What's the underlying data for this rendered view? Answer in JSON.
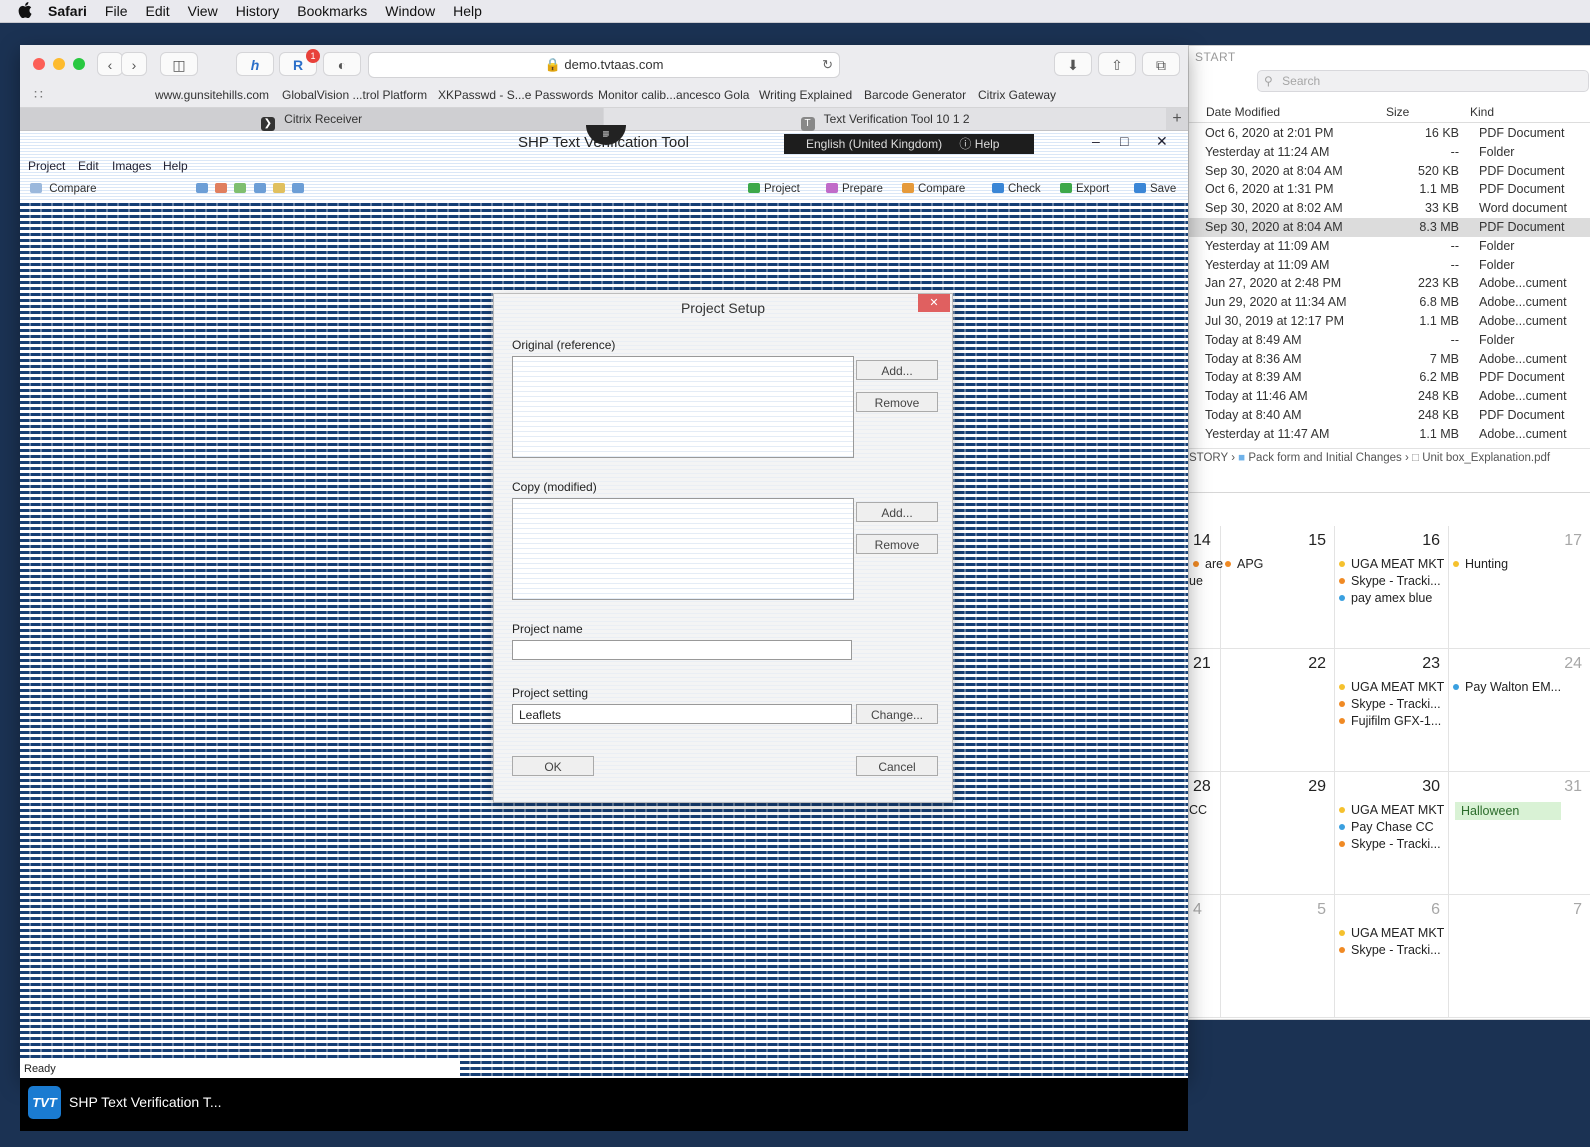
{
  "menubar": {
    "apple": "",
    "items": [
      "Safari",
      "File",
      "Edit",
      "View",
      "History",
      "Bookmarks",
      "Window",
      "Help"
    ]
  },
  "safari": {
    "url": "demo.tvtaas.com",
    "badge": "1",
    "favorites": [
      "www.gunsitehills.com",
      "GlobalVision ...trol Platform",
      "XKPasswd - S...e Passwords",
      "Monitor calib...ancesco Gola",
      "Writing Explained",
      "Barcode Generator",
      "Citrix Gateway"
    ],
    "tabs": [
      {
        "label": "Citrix Receiver",
        "icon": "citrix-icon"
      },
      {
        "label": "Text Verification Tool 10 1 2",
        "icon": "tvt-icon",
        "icon_glyph": "T"
      }
    ],
    "new_tab": "+"
  },
  "app": {
    "title": "SHP Text Verification Tool",
    "language": "English (United Kingdom)",
    "help": "Help",
    "menus": [
      "Project",
      "Edit",
      "Images",
      "Help"
    ],
    "left_tool": "Compare",
    "right_tools": [
      "Project",
      "Prepare",
      "Compare",
      "Check",
      "Export",
      "Save"
    ],
    "status": "Ready"
  },
  "dialog": {
    "title": "Project Setup",
    "original_label": "Original (reference)",
    "copy_label": "Copy (modified)",
    "add": "Add...",
    "remove": "Remove",
    "project_name_label": "Project name",
    "project_setting_label": "Project setting",
    "project_setting_value": "Leaflets",
    "change": "Change...",
    "ok": "OK",
    "cancel": "Cancel"
  },
  "finder": {
    "title": "START",
    "search_placeholder": "Search",
    "columns": {
      "date": "Date Modified",
      "size": "Size",
      "kind": "Kind"
    },
    "rows": [
      {
        "date": "Oct 6, 2020 at 2:01 PM",
        "size": "16 KB",
        "kind": "PDF Document"
      },
      {
        "date": "Yesterday at 11:24 AM",
        "size": "--",
        "kind": "Folder"
      },
      {
        "date": "Sep 30, 2020 at 8:04 AM",
        "size": "520 KB",
        "kind": "PDF Document"
      },
      {
        "date": "Oct 6, 2020 at 1:31 PM",
        "size": "1.1 MB",
        "kind": "PDF Document"
      },
      {
        "date": "Sep 30, 2020 at 8:02 AM",
        "size": "33 KB",
        "kind": "Word document"
      },
      {
        "date": "Sep 30, 2020 at 8:04 AM",
        "size": "8.3 MB",
        "kind": "PDF Document",
        "selected": true
      },
      {
        "date": "Yesterday at 11:09 AM",
        "size": "--",
        "kind": "Folder"
      },
      {
        "date": "Yesterday at 11:09 AM",
        "size": "--",
        "kind": "Folder"
      },
      {
        "date": "Jan 27, 2020 at 2:48 PM",
        "size": "223 KB",
        "kind": "Adobe...cument"
      },
      {
        "date": "Jun 29, 2020 at 11:34 AM",
        "size": "6.8 MB",
        "kind": "Adobe...cument"
      },
      {
        "date": "Jul 30, 2019 at 12:17 PM",
        "size": "1.1 MB",
        "kind": "Adobe...cument"
      },
      {
        "date": "Today at 8:49 AM",
        "size": "--",
        "kind": "Folder"
      },
      {
        "date": "Today at 8:36 AM",
        "size": "7 MB",
        "kind": "Adobe...cument"
      },
      {
        "date": "Today at 8:39 AM",
        "size": "6.2 MB",
        "kind": "PDF Document"
      },
      {
        "date": "Today at 11:46 AM",
        "size": "248 KB",
        "kind": "Adobe...cument"
      },
      {
        "date": "Today at 8:40 AM",
        "size": "248 KB",
        "kind": "PDF Document"
      },
      {
        "date": "Yesterday at 11:47 AM",
        "size": "1.1 MB",
        "kind": "Adobe...cument"
      }
    ],
    "path": [
      "STORY",
      "Pack form and Initial Changes",
      "Unit box_Explanation.pdf"
    ]
  },
  "calendar": {
    "weeks": [
      {
        "days": [
          {
            "num": "14",
            "events": [
              {
                "text": "are",
                "color": "#f08a24"
              },
              {
                "text": "ue",
                "color": ""
              }
            ]
          },
          {
            "num": "15",
            "events": [
              {
                "text": "APG",
                "color": "#f08a24"
              }
            ]
          },
          {
            "num": "16",
            "events": [
              {
                "text": "UGA MEAT MKT",
                "color": "#f5c12e"
              },
              {
                "text": "Skype - Tracki...",
                "color": "#f08a24"
              },
              {
                "text": "pay amex blue",
                "color": "#3aa0e0"
              }
            ]
          },
          {
            "num": "17",
            "dim": true,
            "events": [
              {
                "text": "Hunting",
                "color": "#f5c12e"
              }
            ]
          }
        ]
      },
      {
        "days": [
          {
            "num": "21",
            "events": []
          },
          {
            "num": "22",
            "events": []
          },
          {
            "num": "23",
            "events": [
              {
                "text": "UGA MEAT MKT",
                "color": "#f5c12e"
              },
              {
                "text": "Skype - Tracki...",
                "color": "#f08a24"
              },
              {
                "text": "Fujifilm  GFX-1...",
                "color": "#f08a24"
              }
            ]
          },
          {
            "num": "24",
            "dim": true,
            "events": [
              {
                "text": "Pay Walton EM...",
                "color": "#3aa0e0"
              }
            ]
          }
        ]
      },
      {
        "days": [
          {
            "num": "28",
            "events": [
              {
                "text": "CC",
                "color": ""
              }
            ]
          },
          {
            "num": "29",
            "events": []
          },
          {
            "num": "30",
            "events": [
              {
                "text": "UGA MEAT MKT",
                "color": "#f5c12e"
              },
              {
                "text": "Pay Chase CC",
                "color": "#3aa0e0"
              },
              {
                "text": "Skype - Tracki...",
                "color": "#f08a24"
              }
            ]
          },
          {
            "num": "31",
            "dim": true,
            "halloween": "Halloween",
            "events": []
          }
        ]
      },
      {
        "days": [
          {
            "num": "4",
            "dim": true,
            "events": []
          },
          {
            "num": "5",
            "dim": true,
            "events": []
          },
          {
            "num": "6",
            "dim": true,
            "events": [
              {
                "text": "UGA MEAT MKT",
                "color": "#f5c12e"
              },
              {
                "text": "Skype - Tracki...",
                "color": "#f08a24"
              }
            ]
          },
          {
            "num": "7",
            "dim": true,
            "events": []
          }
        ]
      }
    ]
  },
  "taskbar": {
    "logo": "TVT",
    "app_name": "SHP Text Verification T..."
  }
}
